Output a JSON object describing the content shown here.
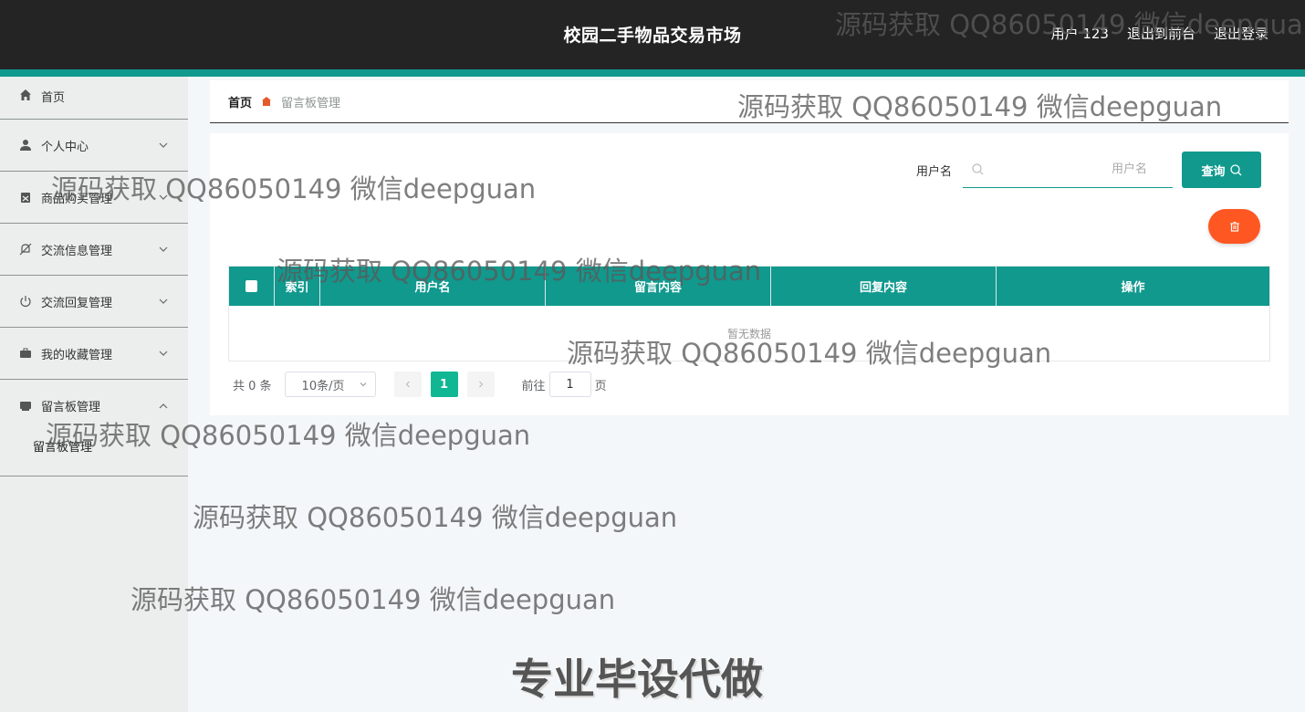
{
  "header": {
    "title": "校园二手物品交易市场",
    "user": "用户 123",
    "exit_front": "退出到前台",
    "logout": "退出登录"
  },
  "sidebar": {
    "items": [
      {
        "label": "首页",
        "icon": "home-icon"
      },
      {
        "label": "个人中心",
        "icon": "user-icon"
      },
      {
        "label": "商品购买管理",
        "icon": "cart-icon"
      },
      {
        "label": "交流信息管理",
        "icon": "bell-off-icon"
      },
      {
        "label": "交流回复管理",
        "icon": "power-icon"
      },
      {
        "label": "我的收藏管理",
        "icon": "briefcase-icon"
      },
      {
        "label": "留言板管理",
        "icon": "message-icon"
      }
    ],
    "submenu": {
      "label": "留言板管理"
    }
  },
  "breadcrumb": {
    "home": "首页",
    "current": "留言板管理"
  },
  "search": {
    "label": "用户名",
    "placeholder": "用户名",
    "value": "",
    "button": "查询"
  },
  "table": {
    "columns": [
      "索引",
      "用户名",
      "留言内容",
      "回复内容",
      "操作"
    ],
    "empty_text": "暂无数据"
  },
  "pagination": {
    "total": "共 0 条",
    "page_size": "10条/页",
    "current_page": "1",
    "goto_prefix": "前往",
    "goto_value": "1",
    "goto_suffix": "页"
  },
  "watermarks": {
    "text": "源码获取 QQ86050149 微信deepguan",
    "banner": "专业毕设代做"
  },
  "colors": {
    "accent": "#11998e",
    "header": "#242424",
    "danger": "#ff5722",
    "page_active": "#11b793"
  }
}
